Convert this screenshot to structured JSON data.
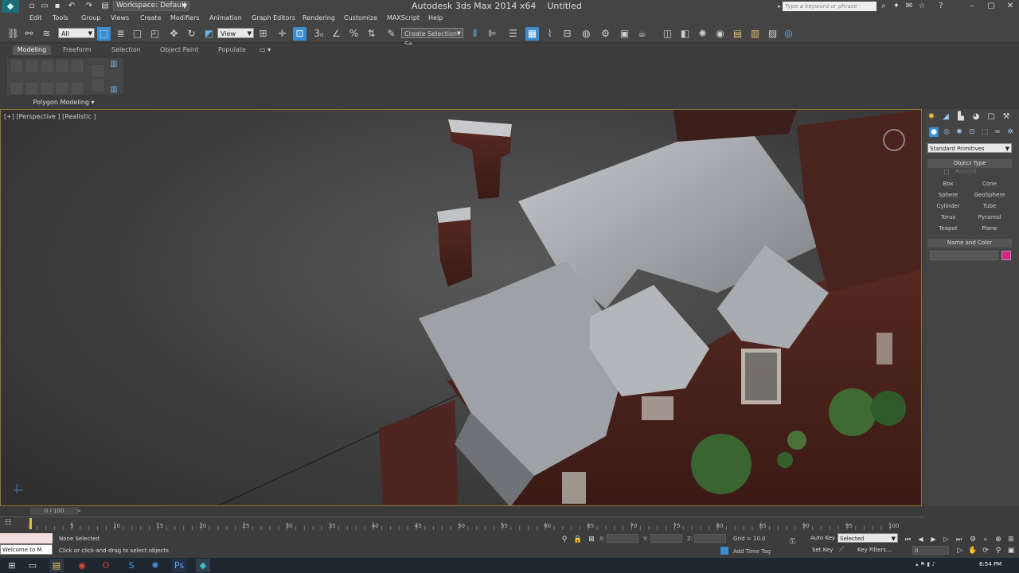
{
  "titlebar": {
    "workspace": "Workspace: Default",
    "app_title": "Autodesk 3ds Max  2014 x64",
    "document_title": "Untitled",
    "search_placeholder": "Type a keyword or phrase"
  },
  "menu": [
    "Edit",
    "Tools",
    "Group",
    "Views",
    "Create",
    "Modifiers",
    "Animation",
    "Graph Editors",
    "Rendering",
    "Customize",
    "MAXScript",
    "Help"
  ],
  "toolbar": {
    "selection_filter": "All",
    "ref_coord": "View",
    "named_selection": "Create Selection Se"
  },
  "ribbon": {
    "tabs": [
      "Modeling",
      "Freeform",
      "Selection",
      "Object Paint",
      "Populate"
    ],
    "panel_label": "Polygon Modeling ▾"
  },
  "viewport": {
    "label": "[+] [Perspective ] [Realistic ]"
  },
  "command_panel": {
    "category": "Standard Primitives",
    "object_type_header": "Object Type",
    "autogrid": "AutoGrid",
    "primitives": [
      "Box",
      "Cone",
      "Sphere",
      "GeoSphere",
      "Cylinder",
      "Tube",
      "Torus",
      "Pyramid",
      "Teapot",
      "Plane"
    ],
    "name_color_header": "Name and Color",
    "object_color": "#e0218a"
  },
  "timeline": {
    "frame_counter": "0 / 100",
    "ticks": [
      "5",
      "10",
      "15",
      "20",
      "25",
      "30",
      "35",
      "40",
      "45",
      "50",
      "55",
      "60",
      "65",
      "70",
      "75",
      "80",
      "85",
      "90",
      "95",
      "100"
    ]
  },
  "status": {
    "maxscript": "Welcome to M",
    "selection": "None Selected",
    "prompt": "Click or click-and-drag to select objects",
    "x_label": "X:",
    "y_label": "Y:",
    "z_label": "Z:",
    "grid": "Grid = 10.0",
    "add_time_tag": "Add Time Tag",
    "auto_key": "Auto Key",
    "set_key": "Set Key",
    "selected_dropdown": "Selected",
    "key_filters": "Key Filters...",
    "frame_value": "0"
  },
  "taskbar": {
    "clock": "6:54 PM"
  }
}
